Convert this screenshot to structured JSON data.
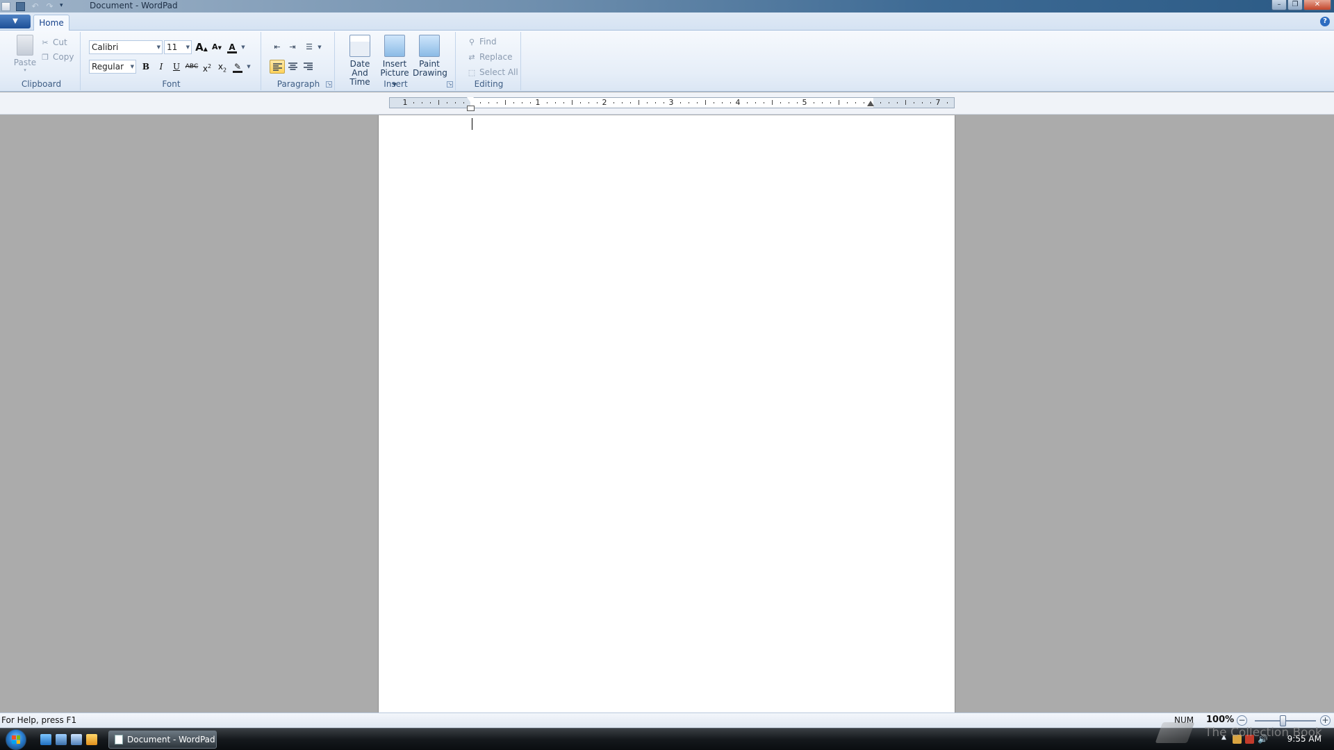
{
  "window": {
    "title": "Document - WordPad"
  },
  "tabs": {
    "home": "Home"
  },
  "ribbon": {
    "clipboard": {
      "label": "Clipboard",
      "paste": "Paste",
      "cut": "Cut",
      "copy": "Copy"
    },
    "font": {
      "label": "Font",
      "family": "Calibri",
      "size": "11",
      "style": "Regular"
    },
    "paragraph": {
      "label": "Paragraph"
    },
    "insert": {
      "label": "Insert",
      "date_line1": "Date And",
      "date_line2": "Time",
      "picture_line1": "Insert",
      "picture_line2": "Picture",
      "paint_line1": "Paint",
      "paint_line2": "Drawing"
    },
    "editing": {
      "label": "Editing",
      "find": "Find",
      "replace": "Replace",
      "select_all": "Select All"
    }
  },
  "ruler": {
    "numbers": [
      "1",
      "1",
      "2",
      "3",
      "4",
      "5",
      "7"
    ]
  },
  "status": {
    "help": "For Help, press F1",
    "num": "NUM",
    "zoom": "100%"
  },
  "taskbar": {
    "task": "Document - WordPad",
    "clock": "9:55 AM"
  },
  "watermark": {
    "text": "The Collection Book"
  },
  "colors": {
    "accent": "#15428b",
    "highlight": "#ffd35c",
    "font_color": "#1c1c1c",
    "highlight_color": "#ffff00"
  }
}
